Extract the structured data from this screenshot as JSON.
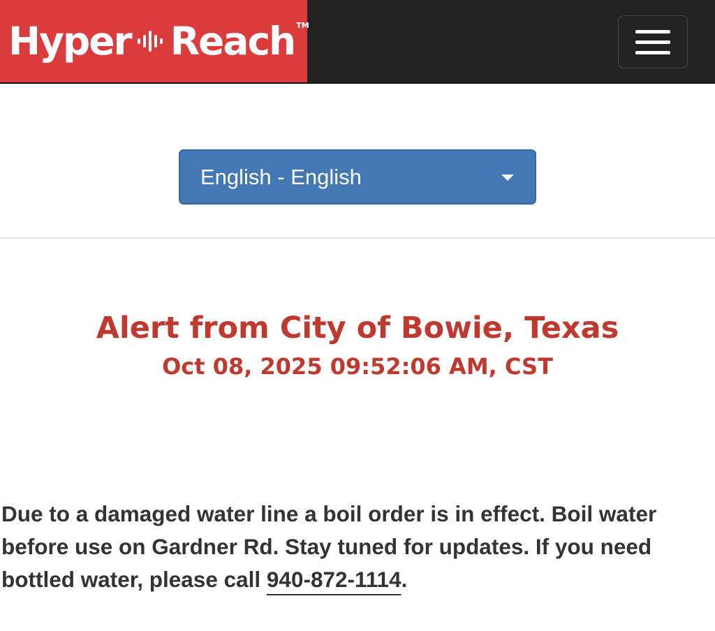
{
  "header": {
    "brand": {
      "left": "Hyper",
      "right": "Reach",
      "trademark": "TM",
      "background": "#dc3b3b",
      "wave_icon": "sound-wave-icon"
    },
    "navbar_background": "#222222",
    "menu_icon": "hamburger-menu-icon"
  },
  "language_select": {
    "selected": "English - English",
    "background": "#4278b4",
    "caret_icon": "caret-down-icon"
  },
  "alert": {
    "title": "Alert from City of Bowie, Texas",
    "timestamp": "Oct 08, 2025 09:52:06 AM, CST",
    "color": "#c0392f"
  },
  "message": {
    "text_before_link": "Due to a damaged water line a boil order is in effect. Boil water before use on Gardner Rd. Stay tuned for updates. If you need bottled water, please call ",
    "phone": "940-872-1114",
    "text_after_link": "."
  }
}
